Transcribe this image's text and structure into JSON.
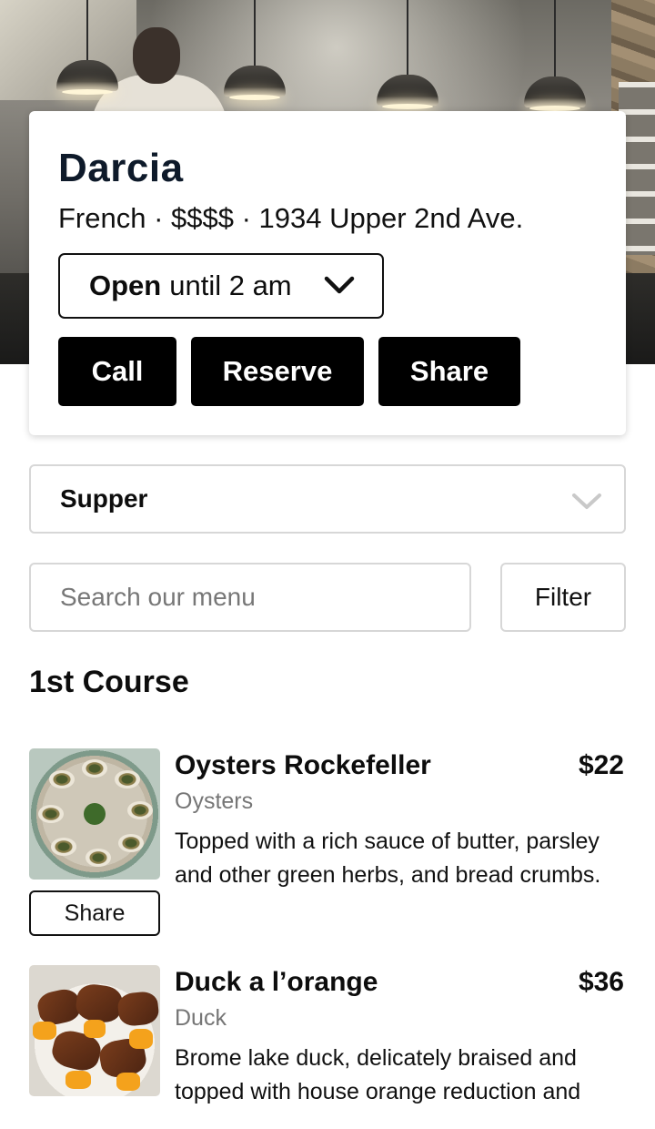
{
  "restaurant": {
    "name": "Darcia",
    "meta": "French · $$$$ · 1934 Upper 2nd Ave.",
    "hours": {
      "open_label": "Open",
      "until_label": "until 2 am"
    },
    "actions": [
      "Call",
      "Reserve",
      "Share"
    ]
  },
  "menu_select": {
    "selected": "Supper"
  },
  "search": {
    "placeholder": "Search our menu",
    "value": ""
  },
  "filter_label": "Filter",
  "section": {
    "title": "1st Course"
  },
  "items": [
    {
      "name": "Oysters Rockefeller",
      "price": "$22",
      "category": "Oysters",
      "description": "Topped with a rich sauce of butter, parsley and other green herbs, and bread crumbs.",
      "share_label": "Share"
    },
    {
      "name": "Duck a l’orange",
      "price": "$36",
      "category": "Duck",
      "description": "Brome lake duck, delicately braised and topped with house orange reduction and"
    }
  ],
  "colors": {
    "primary": "#000000",
    "name_text": "#0e1a2a",
    "muted_text": "#767676",
    "border": "#d7d7d7"
  },
  "icons": {
    "hours_toggle": "chevron-down-icon",
    "menu_toggle": "chevron-down-icon"
  }
}
